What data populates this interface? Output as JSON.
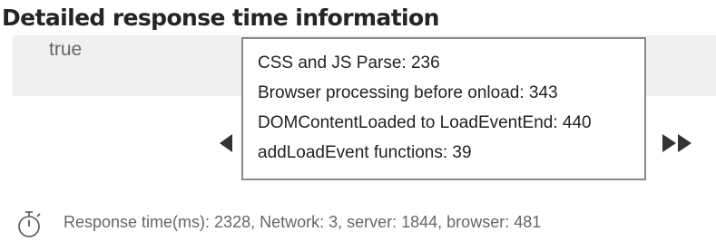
{
  "heading": "Detailed response time information",
  "panel": {
    "value_text": "true"
  },
  "tooltip": {
    "lines": [
      "CSS and JS Parse: 236",
      "Browser processing before onload: 343",
      "DOMContentLoaded to LoadEventEnd: 440",
      "addLoadEvent functions: 39"
    ]
  },
  "footer": {
    "icon": "stopwatch-icon",
    "summary": "Response time(ms): 2328, Network: 3, server: 1844, browser: 481"
  },
  "colors": {
    "heading": "#232426",
    "band": "#f0f0f0",
    "tooltip_border": "#8a8a8a",
    "muted_text": "#666666",
    "arrow": "#333333"
  }
}
